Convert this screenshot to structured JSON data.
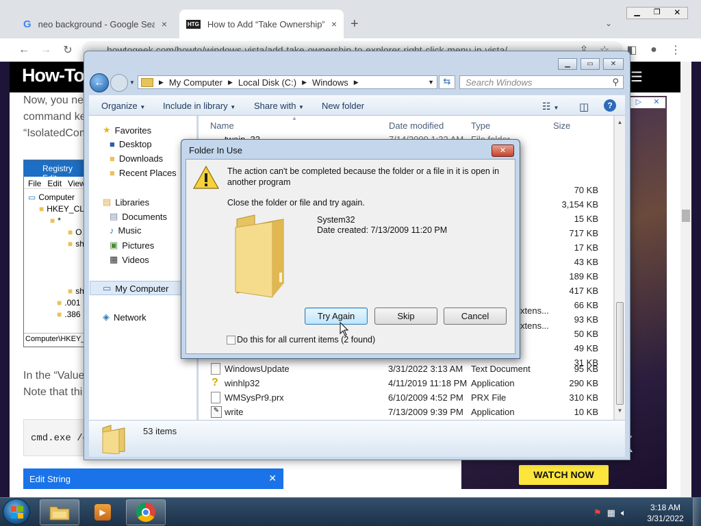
{
  "browser": {
    "tabs": [
      {
        "title": "neo background - Google Search",
        "close": "×"
      },
      {
        "title": "How to Add “Take Ownership” to",
        "close": "×"
      }
    ],
    "new_tab": "+",
    "address": "howtogeek.com/howto/windows-vista/add-take-ownership-to-explorer-right-click-menu-in-vista/"
  },
  "webpage": {
    "logo": "How-To G",
    "lines": [
      "Now, you nee",
      "command ke",
      "“IsolatedCom"
    ],
    "regedit": {
      "title": "Registry Edit",
      "menu": [
        "File",
        "Edit",
        "View"
      ],
      "tree": [
        "Computer",
        "HKEY_CL",
        "*",
        "O",
        "sh",
        "sh",
        ".001",
        ".386"
      ],
      "status": "Computer\\HKEY_"
    },
    "value_lines": [
      "In the “Value",
      "Note that thi"
    ],
    "code": "cmd.exe /c",
    "edit_string": "Edit String",
    "ad_button": "WATCH NOW",
    "ad_text": "IX"
  },
  "explorer": {
    "breadcrumb": [
      "My Computer",
      "Local Disk (C:)",
      "Windows"
    ],
    "search_placeholder": "Search Windows",
    "toolbar": {
      "organize": "Organize",
      "include": "Include in library",
      "share": "Share with",
      "new_folder": "New folder"
    },
    "nav": {
      "favorites": "Favorites",
      "fav_items": [
        "Desktop",
        "Downloads",
        "Recent Places"
      ],
      "libraries": "Libraries",
      "lib_items": [
        "Documents",
        "Music",
        "Pictures",
        "Videos"
      ],
      "computer": "My Computer",
      "network": "Network"
    },
    "columns": [
      "Name",
      "Date modified",
      "Type",
      "Size"
    ],
    "partial_row": {
      "name": "twain_32",
      "date": "7/14/2009 1:32 AM",
      "type": "File folder"
    },
    "hidden_sizes": [
      "70 KB",
      "3,154 KB",
      "15 KB",
      "717 KB",
      "17 KB",
      "43 KB",
      "189 KB",
      "417 KB",
      "66 KB",
      "93 KB",
      "50 KB",
      "49 KB",
      "31 KB"
    ],
    "hidden_types": [
      "xtens...",
      "xtens..."
    ],
    "rows": [
      {
        "name": "WindowsUpdate",
        "date": "3/31/2022 3:13 AM",
        "type": "Text Document",
        "size": "95 KB",
        "icon": "text-file-icon"
      },
      {
        "name": "winhlp32",
        "date": "4/11/2019 11:18 PM",
        "type": "Application",
        "size": "290 KB",
        "icon": "help-app-icon"
      },
      {
        "name": "WMSysPr9.prx",
        "date": "6/10/2009 4:52 PM",
        "type": "PRX File",
        "size": "310 KB",
        "icon": "file-icon"
      },
      {
        "name": "write",
        "date": "7/13/2009 9:39 PM",
        "type": "Application",
        "size": "10 KB",
        "icon": "write-app-icon"
      }
    ],
    "item_count": "53 items"
  },
  "dialog": {
    "title": "Folder In Use",
    "message": "The action can't be completed because the folder or a file in it is open in another program",
    "instruction": "Close the folder or file and try again.",
    "item_name": "System32",
    "item_date": "Date created: 7/13/2009 11:20 PM",
    "buttons": {
      "try_again": "Try Again",
      "skip": "Skip",
      "cancel": "Cancel"
    },
    "checkbox_label": "Do this for all current items (2 found)",
    "checkbox_checked": false
  },
  "taskbar": {
    "time": "3:18 AM",
    "date": "3/31/2022"
  }
}
